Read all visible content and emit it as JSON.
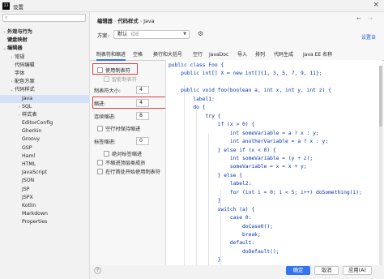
{
  "window": {
    "title": "设置",
    "app_icon": "IJ"
  },
  "search": {
    "placeholder": ""
  },
  "sidebar": {
    "items": [
      {
        "label": "外观与行为",
        "bold": true,
        "arrow": "›",
        "indent": 0
      },
      {
        "label": "键盘映射",
        "bold": true,
        "arrow": "",
        "indent": 0
      },
      {
        "label": "编辑器",
        "bold": true,
        "arrow": "⌄",
        "indent": 0
      },
      {
        "label": "常规",
        "bold": false,
        "arrow": "›",
        "indent": 1
      },
      {
        "label": "代码编辑",
        "bold": false,
        "arrow": "",
        "indent": 1
      },
      {
        "label": "字体",
        "bold": false,
        "arrow": "",
        "indent": 1
      },
      {
        "label": "配色方案",
        "bold": false,
        "arrow": "›",
        "indent": 1
      },
      {
        "label": "代码样式",
        "bold": false,
        "arrow": "⌄",
        "indent": 1
      },
      {
        "label": "Java",
        "bold": false,
        "arrow": "",
        "indent": 2,
        "selected": true
      },
      {
        "label": "SQL",
        "bold": false,
        "arrow": "›",
        "indent": 2
      },
      {
        "label": "样式表",
        "bold": false,
        "arrow": "›",
        "indent": 2
      },
      {
        "label": "EditorConfig",
        "bold": false,
        "arrow": "",
        "indent": 2
      },
      {
        "label": "Gherkin",
        "bold": false,
        "arrow": "",
        "indent": 2
      },
      {
        "label": "Groovy",
        "bold": false,
        "arrow": "",
        "indent": 2
      },
      {
        "label": "GSP",
        "bold": false,
        "arrow": "",
        "indent": 2
      },
      {
        "label": "Haml",
        "bold": false,
        "arrow": "",
        "indent": 2
      },
      {
        "label": "HTML",
        "bold": false,
        "arrow": "",
        "indent": 2
      },
      {
        "label": "JavaScript",
        "bold": false,
        "arrow": "",
        "indent": 2
      },
      {
        "label": "JSON",
        "bold": false,
        "arrow": "",
        "indent": 2
      },
      {
        "label": "JSP",
        "bold": false,
        "arrow": "",
        "indent": 2
      },
      {
        "label": "JSPX",
        "bold": false,
        "arrow": "",
        "indent": 2
      },
      {
        "label": "Kotlin",
        "bold": false,
        "arrow": "",
        "indent": 2
      },
      {
        "label": "Markdown",
        "bold": false,
        "arrow": "",
        "indent": 2
      },
      {
        "label": "Properties",
        "bold": false,
        "arrow": "",
        "indent": 2
      }
    ]
  },
  "breadcrumb": {
    "part1": "编辑器",
    "part2": "代码样式",
    "part3": "Java",
    "separator": "›"
  },
  "nav": {
    "back": "←",
    "forward": "→"
  },
  "scheme": {
    "label": "方案:",
    "value": "默认",
    "suffix": "IDE",
    "link": "设置自"
  },
  "tabs": [
    "制表符和缩进",
    "空格",
    "换行和大括号",
    "空行",
    "JavaDoc",
    "导入",
    "排列",
    "代码生成",
    "Java EE 名称"
  ],
  "options": {
    "use_tab": "使用制表符",
    "smart_tab": "智能制表符",
    "tab_size_label": "制表符大小:",
    "tab_size": "4",
    "indent_label": "缩进:",
    "indent": "4",
    "cont_indent_label": "连续缩进:",
    "cont_indent": "8",
    "keep_indents": "空行时保持缩进",
    "label_indent_label": "标签缩进:",
    "label_indent": "0",
    "absolute_label": "绝对标签缩进",
    "no_indent_top": "不缩进顶层类成员",
    "first_col_comment": "在行首处开始使用制表符"
  },
  "code_lines": [
    "public class Foo {",
    "    public int[] X = new int[]{1, 3, 5, 7, 9, 11};",
    "",
    "    public void foo(boolean a, int x, int y, int z) {",
    "        label1:",
    "        do {",
    "            try {",
    "                if (x > 0) {",
    "                    int someVariable = a ? x : y;",
    "                    int anotherVariable = a ? x : y;",
    "                } else if (x < 0) {",
    "                    int someVariable = (y + z);",
    "                    someVariable = x = x + y;",
    "                } else {",
    "                    label2:",
    "                    for (int i = 0; i < 5; i++) doSomething(i);",
    "                }",
    "                switch (a) {",
    "                    case 0:",
    "                        doCase0();",
    "                        break;",
    "                    default:",
    "                        doDefault();",
    "                }"
  ],
  "footer": {
    "ok": "确定",
    "cancel": "取消",
    "apply": "应用(A)",
    "help": "?"
  },
  "colors": {
    "accent": "#3574f0",
    "highlight_box": "#e03d3d",
    "selection": "#d5e1f6",
    "keyword": "#0033b3"
  }
}
